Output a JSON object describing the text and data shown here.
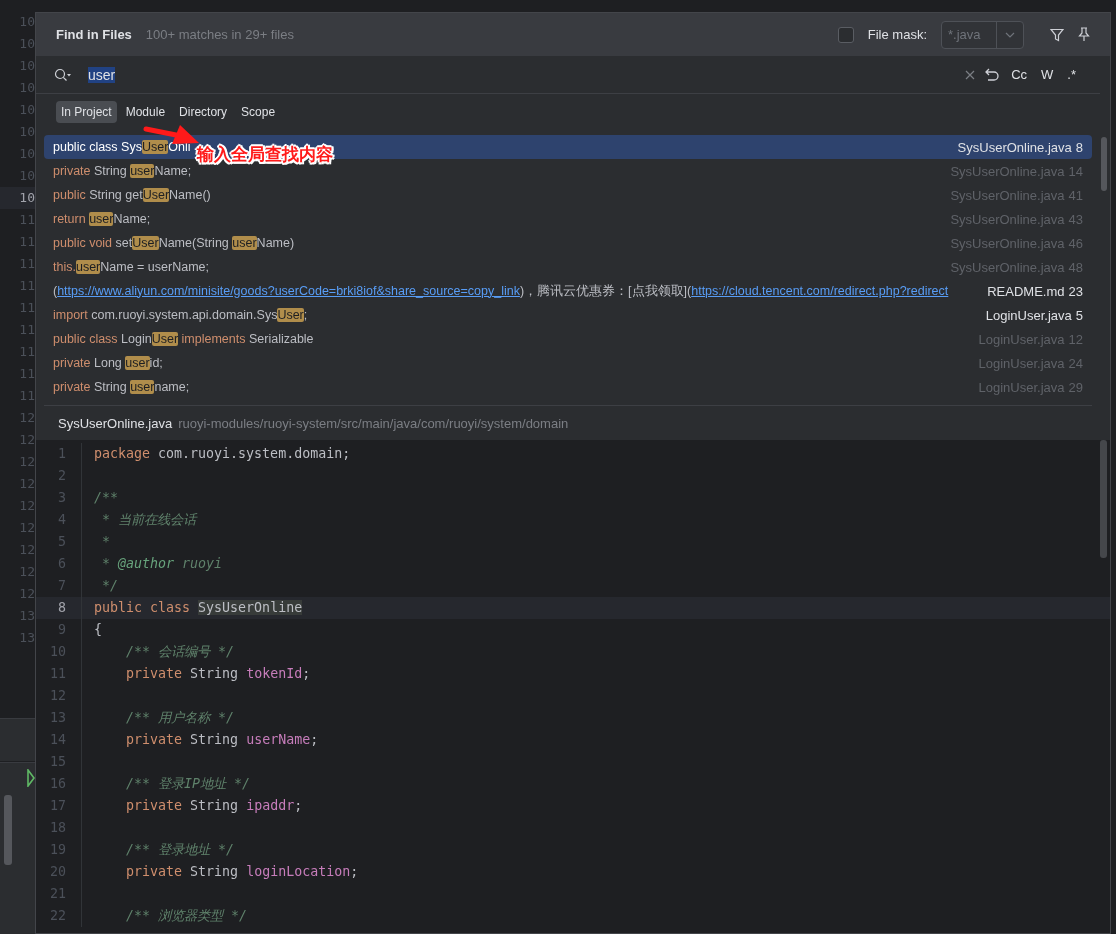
{
  "background_editor": {
    "line_numbers": [
      {
        "number": "10",
        "current": false
      },
      {
        "number": "10",
        "current": false
      },
      {
        "number": "10",
        "current": false
      },
      {
        "number": "10",
        "current": false
      },
      {
        "number": "10",
        "current": false
      },
      {
        "number": "10",
        "current": false
      },
      {
        "number": "10",
        "current": false
      },
      {
        "number": "10",
        "current": false
      },
      {
        "number": "10",
        "current": true
      },
      {
        "number": "11",
        "current": false
      },
      {
        "number": "11",
        "current": false
      },
      {
        "number": "11",
        "current": false
      },
      {
        "number": "11",
        "current": false
      },
      {
        "number": "11",
        "current": false
      },
      {
        "number": "11",
        "current": false
      },
      {
        "number": "11",
        "current": false
      },
      {
        "number": "11",
        "current": false
      },
      {
        "number": "11",
        "current": false
      },
      {
        "number": "12",
        "current": false
      },
      {
        "number": "12",
        "current": false
      },
      {
        "number": "12",
        "current": false
      },
      {
        "number": "12",
        "current": false
      },
      {
        "number": "12",
        "current": false
      },
      {
        "number": "12",
        "current": false
      },
      {
        "number": "12",
        "current": false
      },
      {
        "number": "12",
        "current": false
      },
      {
        "number": "12",
        "current": false
      },
      {
        "number": "13",
        "current": false
      },
      {
        "number": "13",
        "current": false
      }
    ]
  },
  "dialog": {
    "title": "Find in Files",
    "summary": "100+ matches in 29+ files",
    "file_mask": {
      "label": "File mask:",
      "checked": false,
      "value": "*.java"
    },
    "search": {
      "value": "user",
      "selected": true
    },
    "options": [
      "Cc",
      "W",
      ".*"
    ],
    "scopes": [
      {
        "label": "In Project",
        "selected": true
      },
      {
        "label": "Module",
        "selected": false
      },
      {
        "label": "Directory",
        "selected": false
      },
      {
        "label": "Scope",
        "selected": false
      }
    ],
    "results": [
      {
        "selected": true,
        "dimmed": false,
        "file": "SysUserOnline.java",
        "line": "8",
        "parts": [
          {
            "kind": "keyword",
            "text": "public class "
          },
          {
            "kind": "text",
            "text": "Sys"
          },
          {
            "kind": "match",
            "text": "User"
          },
          {
            "kind": "text",
            "text": "Onli"
          }
        ]
      },
      {
        "selected": false,
        "dimmed": true,
        "file": "SysUserOnline.java",
        "line": "14",
        "parts": [
          {
            "kind": "keyword",
            "text": "private "
          },
          {
            "kind": "text",
            "text": "String "
          },
          {
            "kind": "match",
            "text": "user"
          },
          {
            "kind": "text",
            "text": "Name;"
          }
        ]
      },
      {
        "selected": false,
        "dimmed": true,
        "file": "SysUserOnline.java",
        "line": "41",
        "parts": [
          {
            "kind": "keyword",
            "text": "public "
          },
          {
            "kind": "text",
            "text": "String get"
          },
          {
            "kind": "match",
            "text": "User"
          },
          {
            "kind": "text",
            "text": "Name()"
          }
        ]
      },
      {
        "selected": false,
        "dimmed": true,
        "file": "SysUserOnline.java",
        "line": "43",
        "parts": [
          {
            "kind": "keyword",
            "text": "return "
          },
          {
            "kind": "match",
            "text": "user"
          },
          {
            "kind": "text",
            "text": "Name;"
          }
        ]
      },
      {
        "selected": false,
        "dimmed": true,
        "file": "SysUserOnline.java",
        "line": "46",
        "parts": [
          {
            "kind": "keyword",
            "text": "public void "
          },
          {
            "kind": "text",
            "text": "set"
          },
          {
            "kind": "match",
            "text": "User"
          },
          {
            "kind": "text",
            "text": "Name(String "
          },
          {
            "kind": "match",
            "text": "user"
          },
          {
            "kind": "text",
            "text": "Name)"
          }
        ]
      },
      {
        "selected": false,
        "dimmed": true,
        "file": "SysUserOnline.java",
        "line": "48",
        "parts": [
          {
            "kind": "keyword",
            "text": "this."
          },
          {
            "kind": "match",
            "text": "user"
          },
          {
            "kind": "text",
            "text": "Name = userName;"
          }
        ]
      },
      {
        "selected": false,
        "dimmed": false,
        "file": "README.md",
        "line": "23",
        "parts": [
          {
            "kind": "text",
            "text": "("
          },
          {
            "kind": "link",
            "text": "https://www.aliyun.com/minisite/goods?userCode=brki8iof&share_source=copy_link"
          },
          {
            "kind": "text",
            "text": ")，腾讯云优惠券：[点我领取]("
          },
          {
            "kind": "link",
            "text": "https://cloud.tencent.com/redirect.php?redirect"
          }
        ]
      },
      {
        "selected": false,
        "dimmed": false,
        "file": "LoginUser.java",
        "line": "5",
        "parts": [
          {
            "kind": "keyword",
            "text": "import "
          },
          {
            "kind": "text",
            "text": "com.ruoyi.system.api.domain.Sys"
          },
          {
            "kind": "match",
            "text": "User"
          },
          {
            "kind": "text",
            "text": ";"
          }
        ]
      },
      {
        "selected": false,
        "dimmed": true,
        "file": "LoginUser.java",
        "line": "12",
        "parts": [
          {
            "kind": "keyword",
            "text": "public class "
          },
          {
            "kind": "text",
            "text": "Login"
          },
          {
            "kind": "match",
            "text": "User"
          },
          {
            "kind": "keyword",
            "text": " implements "
          },
          {
            "kind": "text",
            "text": "Serializable"
          }
        ]
      },
      {
        "selected": false,
        "dimmed": true,
        "file": "LoginUser.java",
        "line": "24",
        "parts": [
          {
            "kind": "keyword",
            "text": "private "
          },
          {
            "kind": "text",
            "text": "Long "
          },
          {
            "kind": "match",
            "text": "user"
          },
          {
            "kind": "text",
            "text": "id;"
          }
        ]
      },
      {
        "selected": false,
        "dimmed": true,
        "file": "LoginUser.java",
        "line": "29",
        "parts": [
          {
            "kind": "keyword",
            "text": "private "
          },
          {
            "kind": "text",
            "text": "String "
          },
          {
            "kind": "match",
            "text": "user"
          },
          {
            "kind": "text",
            "text": "name;"
          }
        ]
      }
    ],
    "preview": {
      "file": "SysUserOnline.java",
      "path": "ruoyi-modules/ruoyi-system/src/main/java/com/ruoyi/system/domain",
      "lines": [
        {
          "number": "1",
          "current": false,
          "tokens": [
            {
              "kind": "keyword",
              "text": "package "
            },
            {
              "kind": "text",
              "text": "com.ruoyi.system.domain;"
            }
          ]
        },
        {
          "number": "2",
          "current": false
        },
        {
          "number": "3",
          "current": false,
          "tokens": [
            {
              "kind": "comment",
              "text": "/**"
            }
          ]
        },
        {
          "number": "4",
          "current": false,
          "tokens": [
            {
              "kind": "comment",
              "text": " * 当前在线会话"
            }
          ]
        },
        {
          "number": "5",
          "current": false,
          "tokens": [
            {
              "kind": "comment",
              "text": " *"
            }
          ]
        },
        {
          "number": "6",
          "current": false,
          "tokens": [
            {
              "kind": "comment",
              "text": " * "
            },
            {
              "kind": "doctag",
              "text": "@author"
            },
            {
              "kind": "comment",
              "text": " ruoyi"
            }
          ]
        },
        {
          "number": "7",
          "current": false,
          "tokens": [
            {
              "kind": "comment",
              "text": " */"
            }
          ]
        },
        {
          "number": "8",
          "current": true,
          "tokens": [
            {
              "kind": "keyword",
              "text": "public class "
            },
            {
              "kind": "usage",
              "text": "SysUserOnline"
            }
          ]
        },
        {
          "number": "9",
          "current": false,
          "tokens": [
            {
              "kind": "text",
              "text": "{"
            }
          ]
        },
        {
          "number": "10",
          "current": false,
          "tokens": [
            {
              "kind": "comment",
              "text": "    /** 会话编号 */"
            }
          ]
        },
        {
          "number": "11",
          "current": false,
          "tokens": [
            {
              "kind": "keyword",
              "text": "    private "
            },
            {
              "kind": "text",
              "text": "String "
            },
            {
              "kind": "field",
              "text": "tokenId"
            },
            {
              "kind": "text",
              "text": ";"
            }
          ]
        },
        {
          "number": "12",
          "current": false
        },
        {
          "number": "13",
          "current": false,
          "tokens": [
            {
              "kind": "comment",
              "text": "    /** 用户名称 */"
            }
          ]
        },
        {
          "number": "14",
          "current": false,
          "tokens": [
            {
              "kind": "keyword",
              "text": "    private "
            },
            {
              "kind": "text",
              "text": "String "
            },
            {
              "kind": "field",
              "text": "userName"
            },
            {
              "kind": "text",
              "text": ";"
            }
          ]
        },
        {
          "number": "15",
          "current": false
        },
        {
          "number": "16",
          "current": false,
          "tokens": [
            {
              "kind": "comment",
              "text": "    /** 登录IP地址 */"
            }
          ]
        },
        {
          "number": "17",
          "current": false,
          "tokens": [
            {
              "kind": "keyword",
              "text": "    private "
            },
            {
              "kind": "text",
              "text": "String "
            },
            {
              "kind": "field",
              "text": "ipaddr"
            },
            {
              "kind": "text",
              "text": ";"
            }
          ]
        },
        {
          "number": "18",
          "current": false
        },
        {
          "number": "19",
          "current": false,
          "tokens": [
            {
              "kind": "comment",
              "text": "    /** 登录地址 */"
            }
          ]
        },
        {
          "number": "20",
          "current": false,
          "tokens": [
            {
              "kind": "keyword",
              "text": "    private "
            },
            {
              "kind": "text",
              "text": "String "
            },
            {
              "kind": "field",
              "text": "loginLocation"
            },
            {
              "kind": "text",
              "text": ";"
            }
          ]
        },
        {
          "number": "21",
          "current": false
        },
        {
          "number": "22",
          "current": false,
          "tokens": [
            {
              "kind": "comment",
              "text": "    /** 浏览器类型 */"
            }
          ]
        }
      ]
    }
  },
  "annotation": {
    "label": "输入全局查找内容"
  }
}
